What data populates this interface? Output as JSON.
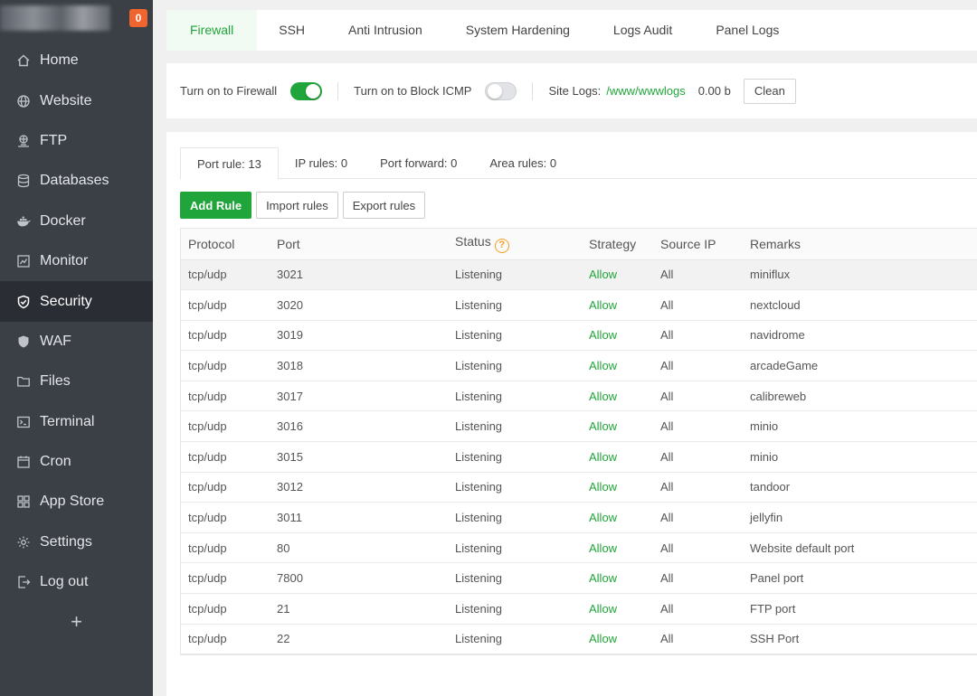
{
  "sidebar": {
    "badge": "0",
    "items": [
      {
        "label": "Home",
        "icon": "home-icon"
      },
      {
        "label": "Website",
        "icon": "globe-icon"
      },
      {
        "label": "FTP",
        "icon": "ftp-icon"
      },
      {
        "label": "Databases",
        "icon": "database-icon"
      },
      {
        "label": "Docker",
        "icon": "docker-icon"
      },
      {
        "label": "Monitor",
        "icon": "monitor-icon"
      },
      {
        "label": "Security",
        "icon": "shield-icon"
      },
      {
        "label": "WAF",
        "icon": "waf-shield-icon"
      },
      {
        "label": "Files",
        "icon": "folder-icon"
      },
      {
        "label": "Terminal",
        "icon": "terminal-icon"
      },
      {
        "label": "Cron",
        "icon": "calendar-icon"
      },
      {
        "label": "App Store",
        "icon": "grid-icon"
      },
      {
        "label": "Settings",
        "icon": "gear-icon"
      },
      {
        "label": "Log out",
        "icon": "logout-icon"
      }
    ],
    "active": "Security",
    "add_label": "+"
  },
  "top_tabs": [
    "Firewall",
    "SSH",
    "Anti Intrusion",
    "System Hardening",
    "Logs Audit",
    "Panel Logs"
  ],
  "toggles": {
    "firewall_label": "Turn on to Firewall",
    "firewall_on": true,
    "icmp_label": "Turn on to Block ICMP",
    "icmp_on": false,
    "site_logs_label": "Site Logs:",
    "site_logs_path": "/www/wwwlogs",
    "site_logs_size": "0.00 b",
    "clean_label": "Clean"
  },
  "sub_tabs": [
    "Port rule: 13",
    "IP rules: 0",
    "Port forward: 0",
    "Area rules: 0"
  ],
  "actions": {
    "add": "Add Rule",
    "import": "Import rules",
    "export": "Export rules"
  },
  "table": {
    "headers": [
      "Protocol",
      "Port",
      "Status",
      "Strategy",
      "Source IP",
      "Remarks"
    ],
    "help_glyph": "?",
    "rows": [
      [
        "tcp/udp",
        "3021",
        "Listening",
        "Allow",
        "All",
        "miniflux"
      ],
      [
        "tcp/udp",
        "3020",
        "Listening",
        "Allow",
        "All",
        "nextcloud"
      ],
      [
        "tcp/udp",
        "3019",
        "Listening",
        "Allow",
        "All",
        "navidrome"
      ],
      [
        "tcp/udp",
        "3018",
        "Listening",
        "Allow",
        "All",
        "arcadeGame"
      ],
      [
        "tcp/udp",
        "3017",
        "Listening",
        "Allow",
        "All",
        "calibreweb"
      ],
      [
        "tcp/udp",
        "3016",
        "Listening",
        "Allow",
        "All",
        "minio"
      ],
      [
        "tcp/udp",
        "3015",
        "Listening",
        "Allow",
        "All",
        "minio"
      ],
      [
        "tcp/udp",
        "3012",
        "Listening",
        "Allow",
        "All",
        "tandoor"
      ],
      [
        "tcp/udp",
        "3011",
        "Listening",
        "Allow",
        "All",
        "jellyfin"
      ],
      [
        "tcp/udp",
        "80",
        "Listening",
        "Allow",
        "All",
        "Website default port"
      ],
      [
        "tcp/udp",
        "7800",
        "Listening",
        "Allow",
        "All",
        "Panel port"
      ],
      [
        "tcp/udp",
        "21",
        "Listening",
        "Allow",
        "All",
        "FTP port"
      ],
      [
        "tcp/udp",
        "22",
        "Listening",
        "Allow",
        "All",
        "SSH Port"
      ]
    ]
  },
  "colors": {
    "accent": "#20a53a",
    "sidebar_bg": "#3b3f46",
    "sidebar_active": "#2a2d33",
    "badge": "#f0642d",
    "help": "#f0a020"
  }
}
